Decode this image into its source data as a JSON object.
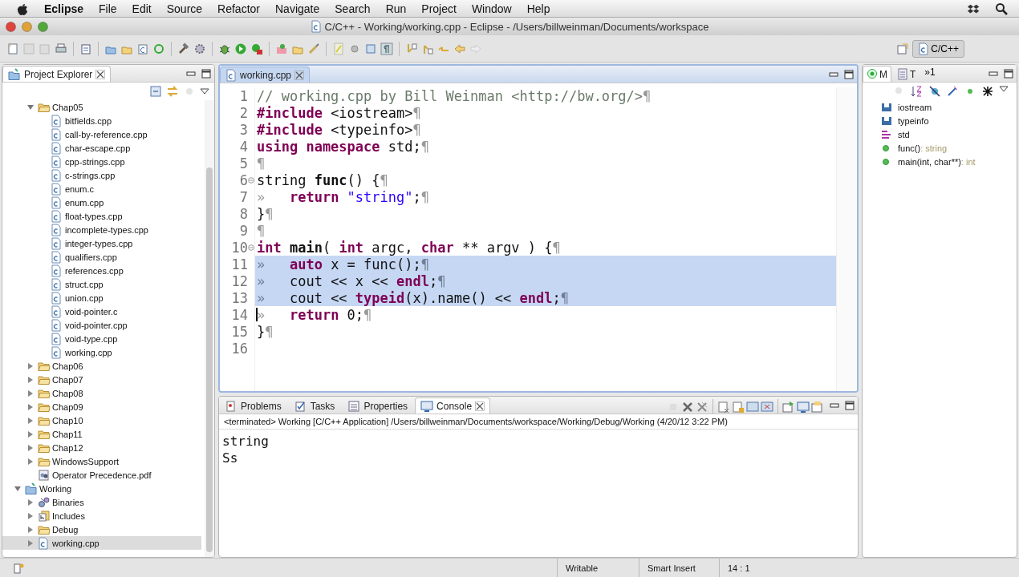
{
  "menubar": {
    "app": "Eclipse",
    "menus": [
      "File",
      "Edit",
      "Source",
      "Refactor",
      "Navigate",
      "Search",
      "Run",
      "Project",
      "Window",
      "Help"
    ]
  },
  "window": {
    "title": "C/C++ - Working/working.cpp - Eclipse - /Users/billweinman/Documents/workspace"
  },
  "perspective": {
    "label": "C/C++",
    "selected": true
  },
  "project_explorer": {
    "title": "Project Explorer",
    "tree": [
      {
        "children": [
          {
            "label": "Chap05",
            "kind": "folder",
            "expanded": true,
            "selected": false,
            "children": [
              {
                "label": "bitfields.cpp",
                "kind": "file",
                "selected": false
              },
              {
                "label": "call-by-reference.cpp",
                "kind": "file",
                "selected": false
              },
              {
                "label": "char-escape.cpp",
                "kind": "file",
                "selected": false
              },
              {
                "label": "cpp-strings.cpp",
                "kind": "file",
                "selected": false
              },
              {
                "label": "c-strings.cpp",
                "kind": "file",
                "selected": false
              },
              {
                "label": "enum.c",
                "kind": "file",
                "selected": false
              },
              {
                "label": "enum.cpp",
                "kind": "file",
                "selected": false
              },
              {
                "label": "float-types.cpp",
                "kind": "file",
                "selected": false
              },
              {
                "label": "incomplete-types.cpp",
                "kind": "file",
                "selected": false
              },
              {
                "label": "integer-types.cpp",
                "kind": "file",
                "selected": false
              },
              {
                "label": "qualifiers.cpp",
                "kind": "file",
                "selected": false
              },
              {
                "label": "references.cpp",
                "kind": "file",
                "selected": false
              },
              {
                "label": "struct.cpp",
                "kind": "file",
                "selected": false
              },
              {
                "label": "union.cpp",
                "kind": "file",
                "selected": false
              },
              {
                "label": "void-pointer.c",
                "kind": "file",
                "selected": false
              },
              {
                "label": "void-pointer.cpp",
                "kind": "file",
                "selected": false
              },
              {
                "label": "void-type.cpp",
                "kind": "file",
                "selected": false
              },
              {
                "label": "working.cpp",
                "kind": "file",
                "selected": false
              }
            ]
          },
          {
            "label": "Chap06",
            "kind": "folder",
            "expanded": false,
            "selected": false
          },
          {
            "label": "Chap07",
            "kind": "folder",
            "expanded": false,
            "selected": false
          },
          {
            "label": "Chap08",
            "kind": "folder",
            "expanded": false,
            "selected": false
          },
          {
            "label": "Chap09",
            "kind": "folder",
            "expanded": false,
            "selected": false
          },
          {
            "label": "Chap10",
            "kind": "folder",
            "expanded": false,
            "selected": false
          },
          {
            "label": "Chap11",
            "kind": "folder",
            "expanded": false,
            "selected": false
          },
          {
            "label": "Chap12",
            "kind": "folder",
            "expanded": false,
            "selected": false
          },
          {
            "label": "WindowsSupport",
            "kind": "folder",
            "expanded": false,
            "selected": false
          },
          {
            "label": "Operator Precedence.pdf",
            "kind": "pdf",
            "selected": false
          }
        ]
      },
      {
        "label": "Working",
        "kind": "project",
        "expanded": true,
        "selected": false,
        "children": [
          {
            "label": "Binaries",
            "kind": "binaries",
            "expanded": false,
            "selected": false
          },
          {
            "label": "Includes",
            "kind": "includes",
            "expanded": false,
            "selected": false
          },
          {
            "label": "Debug",
            "kind": "folder",
            "expanded": false,
            "selected": false
          },
          {
            "label": "working.cpp",
            "kind": "file",
            "expanded": false,
            "selected": true
          }
        ]
      }
    ]
  },
  "editor": {
    "tab": "working.cpp",
    "lines": [
      {
        "number": "1",
        "selected": false,
        "cursor": false,
        "foldable": false,
        "tokens": [
          {
            "kind": "comment",
            "t": "// working.cpp by Bill Weinman <http://bw.org/>"
          },
          {
            "kind": "mark",
            "t": "¶"
          }
        ]
      },
      {
        "number": "2",
        "selected": false,
        "cursor": false,
        "foldable": false,
        "tokens": [
          {
            "kind": "keyword",
            "t": "#include"
          },
          {
            "kind": "plain",
            "t": " <iostream>"
          },
          {
            "kind": "mark",
            "t": "¶"
          }
        ]
      },
      {
        "number": "3",
        "selected": false,
        "cursor": false,
        "foldable": false,
        "tokens": [
          {
            "kind": "keyword",
            "t": "#include"
          },
          {
            "kind": "plain",
            "t": " <typeinfo>"
          },
          {
            "kind": "mark",
            "t": "¶"
          }
        ]
      },
      {
        "number": "4",
        "selected": false,
        "cursor": false,
        "foldable": false,
        "tokens": [
          {
            "kind": "keyword",
            "t": "using namespace"
          },
          {
            "kind": "plain",
            "t": " std;"
          },
          {
            "kind": "mark",
            "t": "¶"
          }
        ]
      },
      {
        "number": "5",
        "selected": false,
        "cursor": false,
        "foldable": false,
        "tokens": [
          {
            "kind": "mark",
            "t": "¶"
          }
        ]
      },
      {
        "number": "6",
        "selected": false,
        "cursor": false,
        "foldable": true,
        "tokens": [
          {
            "kind": "plain",
            "t": "string "
          },
          {
            "kind": "function",
            "t": "func"
          },
          {
            "kind": "plain",
            "t": "() {"
          },
          {
            "kind": "mark",
            "t": "¶"
          }
        ]
      },
      {
        "number": "7",
        "selected": false,
        "cursor": false,
        "foldable": false,
        "tokens": [
          {
            "kind": "mark",
            "t": "»"
          },
          {
            "kind": "keyword",
            "t": "   return"
          },
          {
            "kind": "string",
            "t": " \"string\""
          },
          {
            "kind": "plain",
            "t": ";"
          },
          {
            "kind": "mark",
            "t": "¶"
          }
        ]
      },
      {
        "number": "8",
        "selected": false,
        "cursor": false,
        "foldable": false,
        "tokens": [
          {
            "kind": "plain",
            "t": "}"
          },
          {
            "kind": "mark",
            "t": "¶"
          }
        ]
      },
      {
        "number": "9",
        "selected": false,
        "cursor": false,
        "foldable": false,
        "tokens": [
          {
            "kind": "mark",
            "t": "¶"
          }
        ]
      },
      {
        "number": "10",
        "selected": false,
        "cursor": false,
        "foldable": true,
        "tokens": [
          {
            "kind": "keyword",
            "t": "int"
          },
          {
            "kind": "function",
            "t": " main"
          },
          {
            "kind": "plain",
            "t": "( "
          },
          {
            "kind": "keyword",
            "t": "int"
          },
          {
            "kind": "plain",
            "t": " argc, "
          },
          {
            "kind": "keyword",
            "t": "char"
          },
          {
            "kind": "plain",
            "t": " ** argv ) {"
          },
          {
            "kind": "mark",
            "t": "¶"
          }
        ]
      },
      {
        "number": "11",
        "selected": true,
        "cursor": false,
        "foldable": false,
        "tokens": [
          {
            "kind": "mark",
            "t": "»"
          },
          {
            "kind": "keyword",
            "t": "   auto"
          },
          {
            "kind": "plain",
            "t": " x = func();"
          },
          {
            "kind": "mark",
            "t": "¶"
          }
        ]
      },
      {
        "number": "12",
        "selected": true,
        "cursor": false,
        "foldable": false,
        "tokens": [
          {
            "kind": "mark",
            "t": "»"
          },
          {
            "kind": "plain",
            "t": "   cout << x << "
          },
          {
            "kind": "keyword",
            "t": "endl"
          },
          {
            "kind": "plain",
            "t": ";"
          },
          {
            "kind": "mark",
            "t": "¶"
          }
        ]
      },
      {
        "number": "13",
        "selected": true,
        "cursor": false,
        "foldable": false,
        "tokens": [
          {
            "kind": "mark",
            "t": "»"
          },
          {
            "kind": "plain",
            "t": "   cout << "
          },
          {
            "kind": "keyword",
            "t": "typeid"
          },
          {
            "kind": "plain",
            "t": "(x).name() << "
          },
          {
            "kind": "keyword",
            "t": "endl"
          },
          {
            "kind": "plain",
            "t": ";"
          },
          {
            "kind": "mark",
            "t": "¶"
          }
        ]
      },
      {
        "number": "14",
        "selected": false,
        "cursor": true,
        "foldable": false,
        "tokens": [
          {
            "kind": "mark",
            "t": "»"
          },
          {
            "kind": "keyword",
            "t": "   return"
          },
          {
            "kind": "plain",
            "t": " 0;"
          },
          {
            "kind": "mark",
            "t": "¶"
          }
        ]
      },
      {
        "number": "15",
        "selected": false,
        "cursor": false,
        "foldable": false,
        "tokens": [
          {
            "kind": "plain",
            "t": "}"
          },
          {
            "kind": "mark",
            "t": "¶"
          }
        ]
      },
      {
        "number": "16",
        "selected": false,
        "cursor": false,
        "foldable": false
      }
    ]
  },
  "outline": {
    "tabs": [
      {
        "label": "M",
        "kind": "outline",
        "selected": true
      },
      {
        "label": "T",
        "kind": "type",
        "selected": false
      }
    ],
    "overflow": "»1",
    "items": [
      {
        "name": "iostream",
        "kind": "include"
      },
      {
        "name": "typeinfo",
        "kind": "include"
      },
      {
        "name": "std",
        "kind": "namespace"
      },
      {
        "name": "func()",
        "type": " : string",
        "kind": "function"
      },
      {
        "name": "main(int, char**)",
        "type": " : int",
        "kind": "function"
      }
    ]
  },
  "bottom_panel": {
    "tabs": [
      {
        "label": "Problems",
        "kind": "problems",
        "selected": false
      },
      {
        "label": "Tasks",
        "kind": "tasks",
        "selected": false
      },
      {
        "label": "Properties",
        "kind": "properties",
        "selected": false
      },
      {
        "label": "Console",
        "kind": "console",
        "selected": true
      }
    ],
    "console_header": "<terminated> Working [C/C++ Application] /Users/billweinman/Documents/workspace/Working/Debug/Working (4/20/12 3:22 PM)",
    "output": [
      "string",
      "Ss"
    ]
  },
  "status_bar": {
    "fields": [
      "Writable",
      "Smart Insert",
      "14 : 1"
    ]
  }
}
